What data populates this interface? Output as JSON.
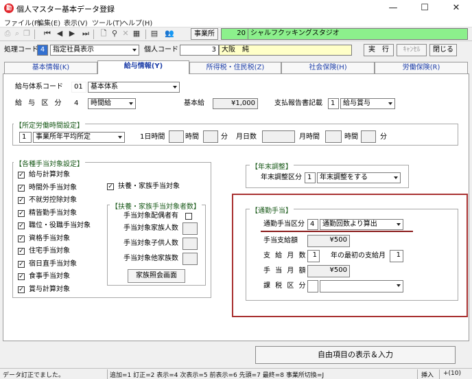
{
  "window": {
    "title": "個人マスター基本データ登録",
    "icon_text": "勤",
    "minimize": "—",
    "maximize": "☐",
    "close": "✕"
  },
  "menu": [
    "ファイル(F)",
    "編集(E)",
    "表示(V)",
    "ツール(T)",
    "ヘルプ(H)"
  ],
  "toolbar": {
    "office_label": "事業所",
    "office_code": "20",
    "office_name": "シャルフクッキングスタジオ"
  },
  "header": {
    "proc_label": "処理コード",
    "proc_code": "4",
    "proc_value": "指定社員表示",
    "person_label": "個人コード",
    "person_code": "3",
    "person_name": "大阪　純",
    "exec": "実　行",
    "cancel": "ｷｬﾝｾﾙ",
    "close": "閉じる"
  },
  "tabs": [
    {
      "label": "基本情報(K)"
    },
    {
      "label": "給与情報(Y)"
    },
    {
      "label": "所得税・住民税(Z)"
    },
    {
      "label": "社会保険(H)"
    },
    {
      "label": "労働保険(R)"
    }
  ],
  "salary": {
    "system_label": "給与体系コード",
    "system_code": "01",
    "system_value": "基本体系",
    "class_label": "給 与 区 分",
    "class_code": "4",
    "class_value": "時間給",
    "base_label": "基本給",
    "base_value": "¥1,000",
    "report_label": "支払報告書記載",
    "report_code": "1",
    "report_value": "給与賞与"
  },
  "work_hours": {
    "title": "【所定労働時間設定】",
    "code": "1",
    "value": "事業所年平均所定",
    "day_hours": "1日時間",
    "hours": "時間",
    "min1": "分",
    "month_days": "月日数",
    "month_hours": "月時間",
    "min2": "分"
  },
  "allowances": {
    "title": "【各種手当対象設定】",
    "items": [
      "給与計算対象",
      "時間外手当対象",
      "不就労控除対象",
      "精皆勤手当対象",
      "職位・役職手当対象",
      "資格手当対象",
      "住宅手当対象",
      "宿日直手当対象",
      "食事手当対象",
      "賞与計算対象"
    ],
    "dependent": "扶養・家族手当対象",
    "count_title": "【扶養・家族手当対象者数】",
    "spouse": "手当対象配偶者有",
    "family": "手当対象家族人数",
    "children": "手当対象子供人数",
    "others": "手当対象他家族数",
    "family_button": "家族照会画面"
  },
  "year_end": {
    "title": "【年末調整】",
    "label": "年末調整区分",
    "code": "1",
    "value": "年末調整をする"
  },
  "commute": {
    "title": "【通勤手当】",
    "type_label": "通勤手当区分",
    "type_code": "4",
    "type_value": "通勤回数より算出",
    "pay_label": "手当支給額",
    "pay_value": "¥500",
    "months_label": "支 給 月 数",
    "months_value": "1",
    "first_label": "年の最初の支給月",
    "first_value": "1",
    "monthly_label": "手 当 月 額",
    "monthly_value": "¥500",
    "tax_label": "課 税 区 分",
    "tax_code": "",
    "tax_value": ""
  },
  "free_items_button": "自由項目の表示＆入力",
  "status": {
    "message": "データ訂正でました。",
    "keys": "追加=1 訂正=2 表示=4 次表示=5 前表示=6 先頭=7 最終=8 事業所切換=J",
    "mode": "挿入",
    "extra": "+(10)"
  },
  "colors": {
    "highlight_border": "#a83030",
    "underline": "#8a1a1a",
    "office_bg": "#8cf08c",
    "name_bg": "#ffffc8"
  }
}
